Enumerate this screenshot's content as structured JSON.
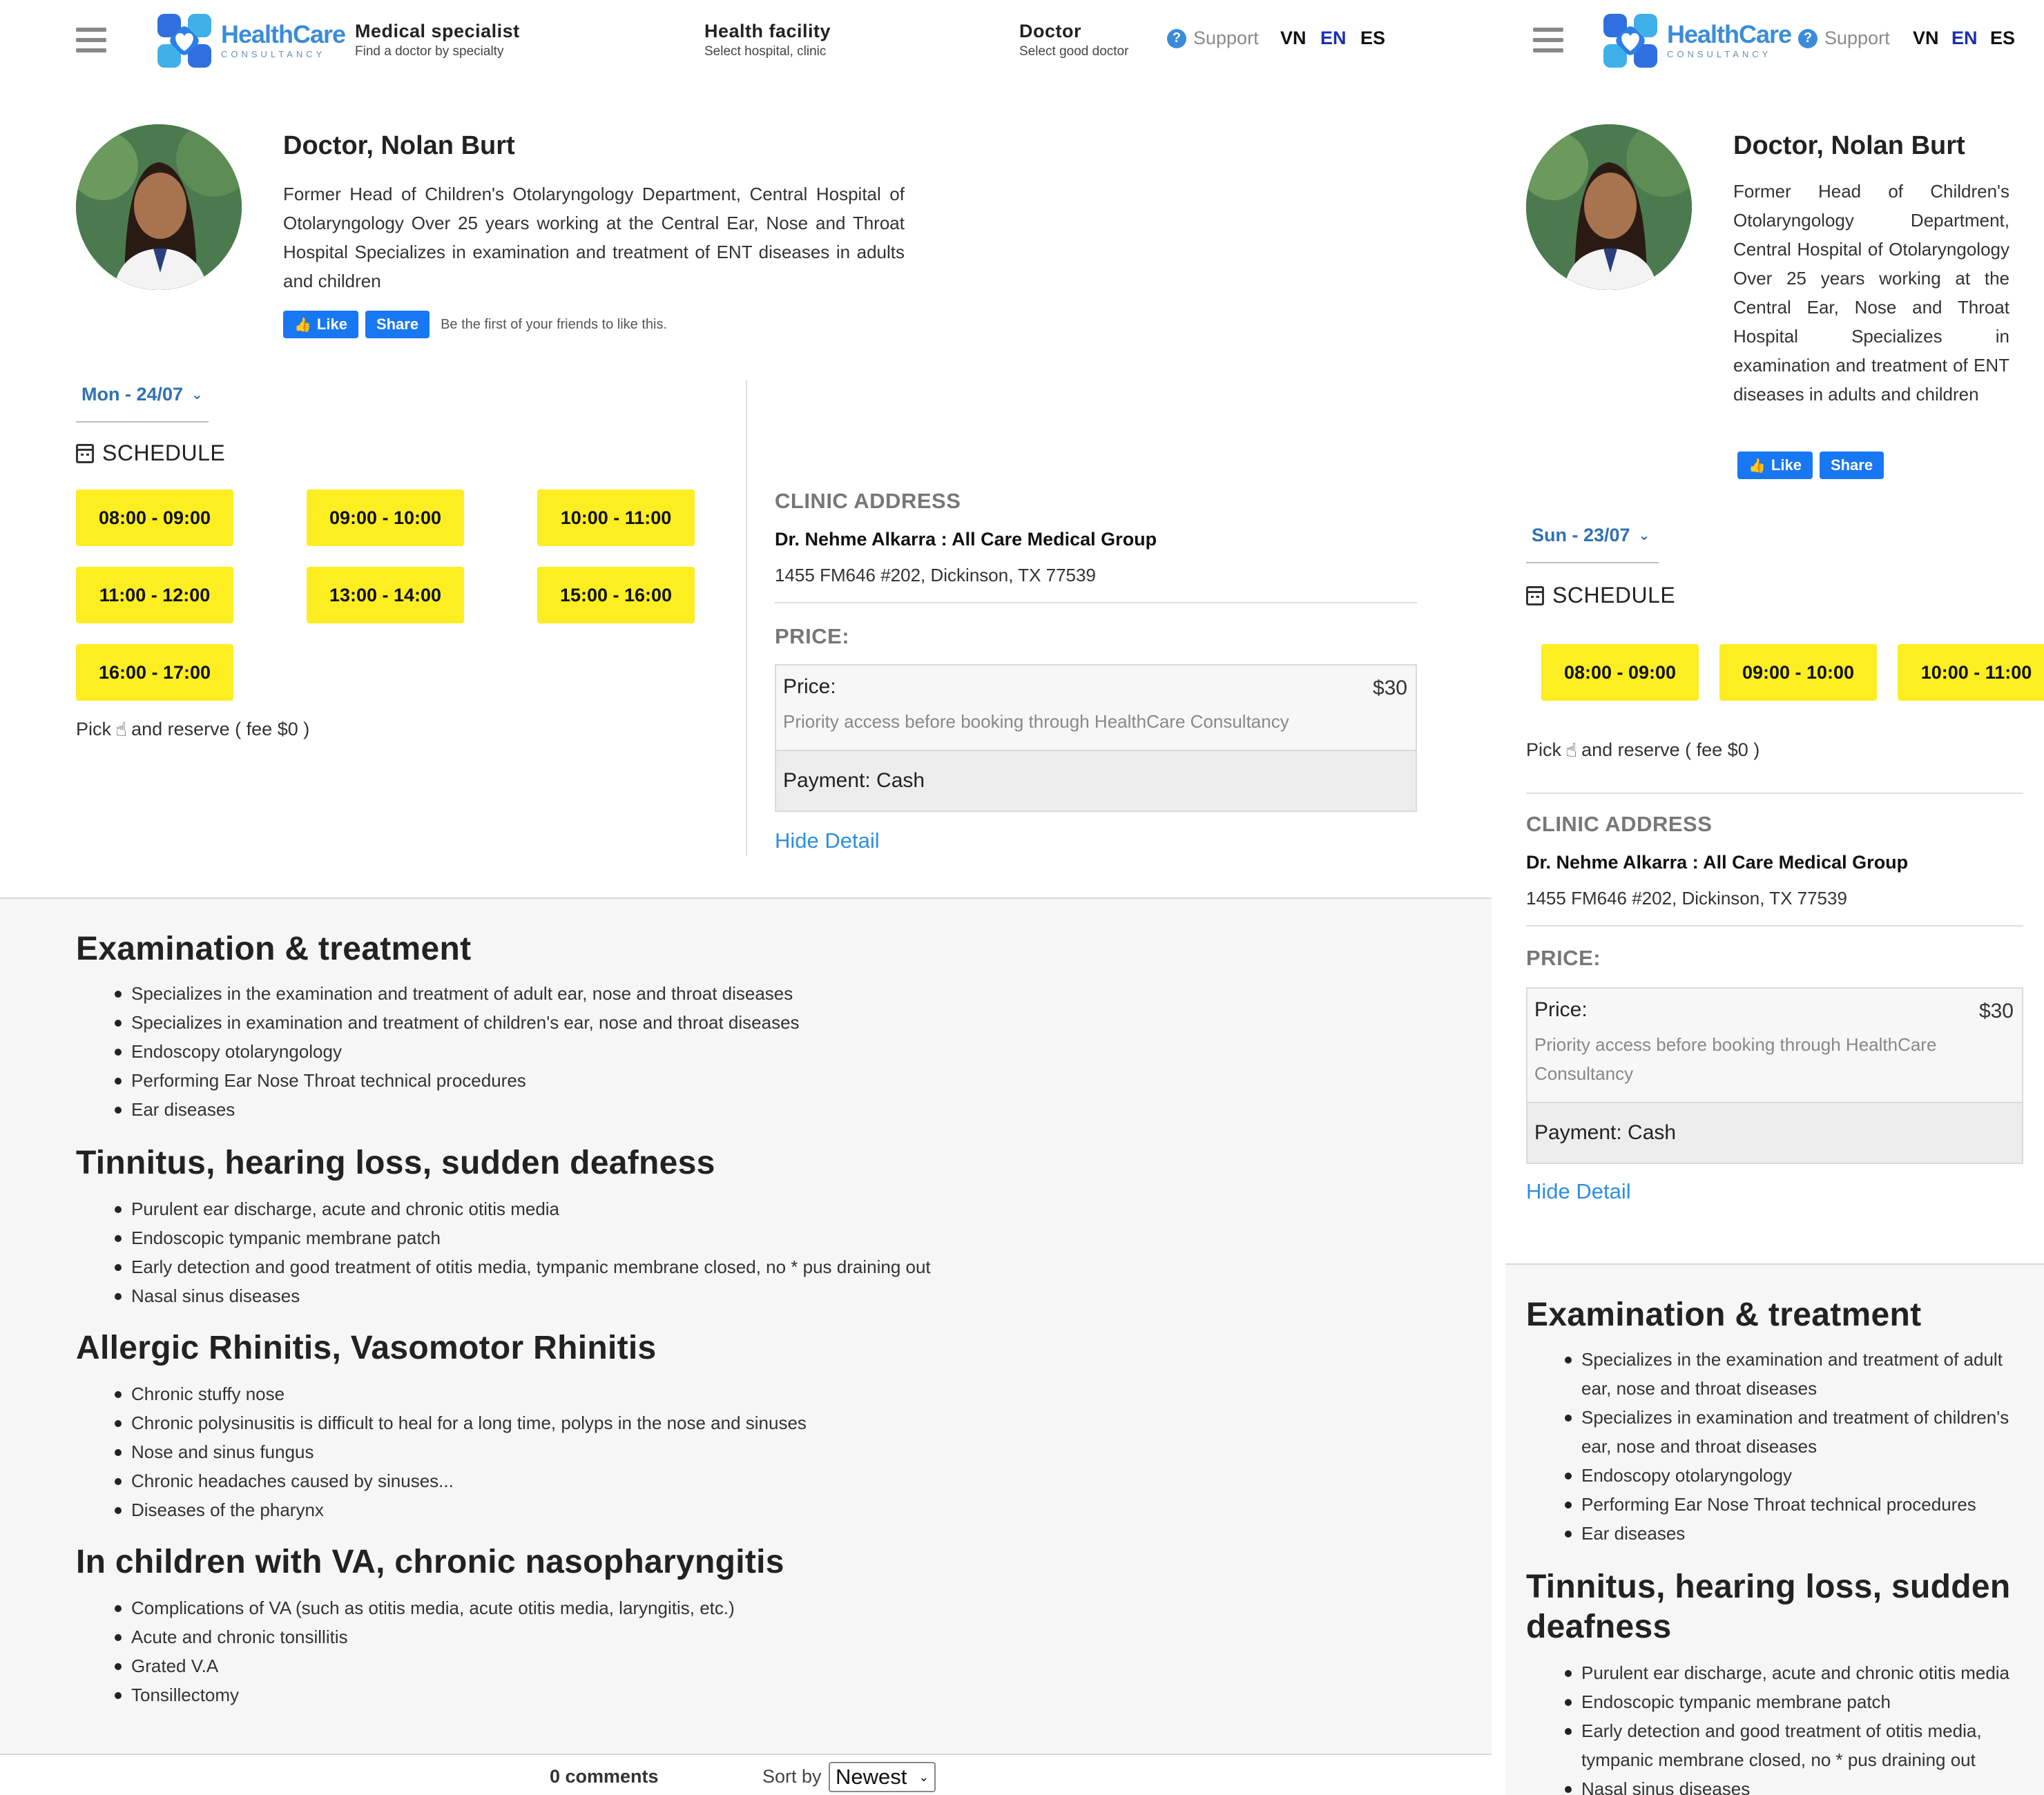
{
  "header": {
    "logo_line1": "HealthCare",
    "logo_line2": "CONSULTANCY",
    "nav": [
      {
        "title": "Medical specialist",
        "subtitle": "Find a doctor by specialty"
      },
      {
        "title": "Health facility",
        "subtitle": "Select hospital, clinic"
      },
      {
        "title": "Doctor",
        "subtitle": "Select good doctor"
      }
    ],
    "support": "Support",
    "languages": [
      "VN",
      "EN",
      "ES"
    ],
    "active_language": "EN"
  },
  "doctor": {
    "name": "Doctor, Nolan Burt",
    "description": "Former Head of Children's Otolaryngology Department, Central Hospital of Otolaryngology Over 25 years working at the Central Ear, Nose and Throat Hospital Specializes in examination and treatment of ENT diseases in adults and children"
  },
  "facebook": {
    "like": "Like",
    "share": "Share",
    "note": "Be the first of your friends to like this."
  },
  "booking_left": {
    "date": "Mon - 24/07",
    "schedule_title": "SCHEDULE",
    "slots": [
      "08:00 - 09:00",
      "09:00 - 10:00",
      "10:00 - 11:00",
      "11:00 - 12:00",
      "13:00 - 14:00",
      "15:00 - 16:00",
      "16:00 - 17:00"
    ],
    "pick_before": "Pick",
    "pick_after": "and reserve ( fee $0 )"
  },
  "booking_right": {
    "date": "Sun - 23/07",
    "slots": [
      "08:00 - 09:00",
      "09:00 - 10:00",
      "10:00 - 11:00"
    ]
  },
  "clinic": {
    "section_title": "CLINIC ADDRESS",
    "name": "Dr. Nehme Alkarra : All Care Medical Group",
    "address": "1455 FM646 #202, Dickinson, TX 77539"
  },
  "price": {
    "section_title": "PRICE:",
    "label": "Price:",
    "value": "$30",
    "note": "Priority access before booking through HealthCare Consultancy",
    "payment": "Payment: Cash",
    "hide_detail": "Hide Detail"
  },
  "details": [
    {
      "title": "Examination & treatment",
      "items": [
        "Specializes in the examination and treatment of adult ear, nose and throat diseases",
        "Specializes in examination and treatment of children's ear, nose and throat diseases",
        "Endoscopy otolaryngology",
        "Performing Ear Nose Throat technical procedures",
        "Ear diseases"
      ]
    },
    {
      "title": "Tinnitus, hearing loss, sudden deafness",
      "items": [
        "Purulent ear discharge, acute and chronic otitis media",
        "Endoscopic tympanic membrane patch",
        "Early detection and good treatment of otitis media, tympanic membrane closed, no * pus draining out",
        "Nasal sinus diseases"
      ]
    },
    {
      "title": "Allergic Rhinitis, Vasomotor Rhinitis",
      "items": [
        "Chronic stuffy nose",
        "Chronic polysinusitis is difficult to heal for a long time, polyps in the nose and sinuses",
        "Nose and sinus fungus",
        "Chronic headaches caused by sinuses...",
        "Diseases of the pharynx"
      ]
    },
    {
      "title": "In children with VA, chronic nasopharyngitis",
      "items": [
        "Complications of VA (such as otitis media, acute otitis media, laryngitis, etc.)",
        "Acute and chronic tonsillitis",
        "Grated V.A",
        "Tonsillectomy"
      ]
    }
  ],
  "comments": {
    "count": "0 comments",
    "sort_label": "Sort by",
    "sort_value": "Newest"
  }
}
